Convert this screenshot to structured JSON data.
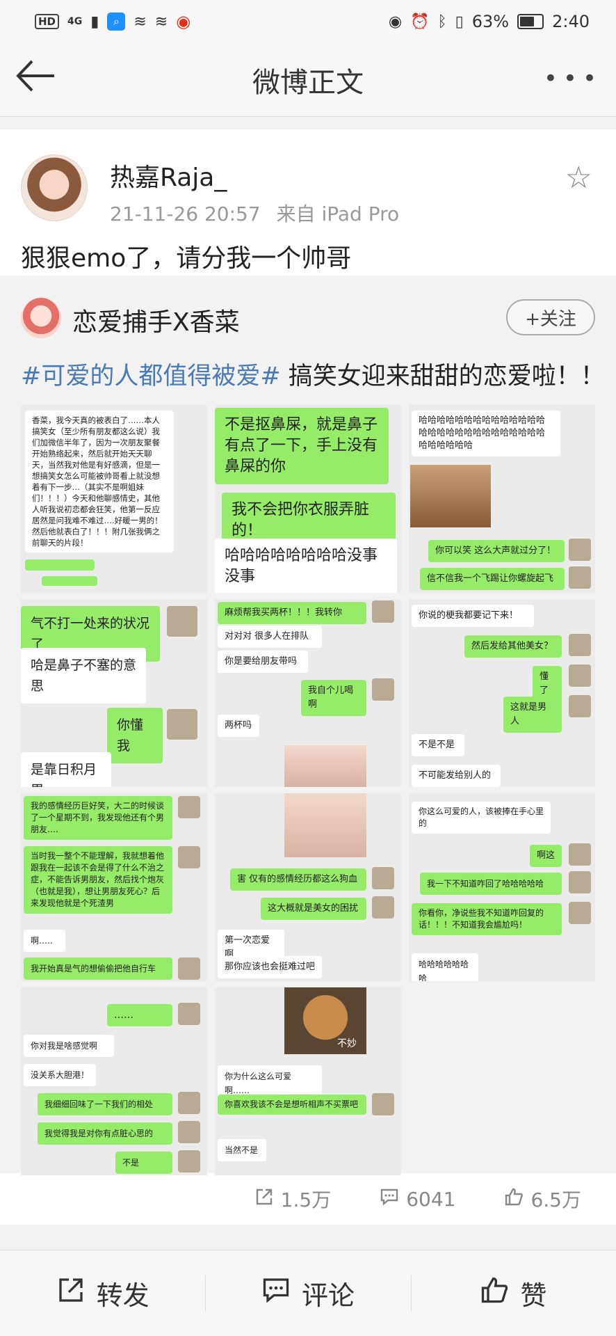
{
  "status_bar": {
    "left_badges": [
      "HD",
      "4G"
    ],
    "battery_percent": "63%",
    "time": "2:40"
  },
  "nav": {
    "title": "微博正文"
  },
  "post": {
    "author": "热嘉Raja_",
    "timestamp": "21-11-26 20:57",
    "source": "来自 iPad Pro",
    "text": "狠狠emo了，请分我一个帅哥"
  },
  "repost": {
    "author": "恋爱捕手X香菜",
    "follow_label": "+关注",
    "hashtag": "#可爱的人都值得被爱#",
    "text": " 搞笑女迎来甜甜的恋爱啦！！"
  },
  "grid": {
    "c1": {
      "story": "香菜，我今天真的被表白了……本人搞笑女（至少所有朋友都这么说）我们加微信半年了，因为一次朋友聚餐开始熟络起来，然后就开始天天聊天，当然我对他是有好感滴，但是一想搞笑女怎么可能被帅哥看上就没想着有下一步…（其实不是啊姐妹们！！！）今天和他聊感情史，其他人听我说初恋都会狂笑，他第一反应居然是问我难不难过….好暖一男的！然后他就表白了！！！附几张我俩之前聊天的片段！"
    },
    "c2": {
      "b1": "不是抠鼻屎，就是鼻子有点了一下，手上没有鼻屎的你",
      "b2": "我不会把你衣服弄脏的！",
      "b3": "哈哈哈哈哈哈哈哈没事没事"
    },
    "c3": {
      "b1": "哈哈哈哈哈哈哈哈哈哈哈哈哈哈哈哈哈哈哈哈哈哈哈哈哈哈哈哈哈哈哈哈哈哈",
      "b2": "你可以笑 这么大声就过分了！",
      "b3": "信不信我一个飞踢让你螺旋起飞"
    },
    "c4": {
      "b1": "气不打一处来的状况了",
      "b2": "哈是鼻子不塞的意思",
      "b3": "你懂我",
      "b4": "是靠日积月累"
    },
    "c5": {
      "b1": "麻烦帮我买两杯！！！我转你",
      "b2": "对对对 很多人在排队",
      "b3": "你是要给朋友带吗",
      "b4": "我自个儿喝啊",
      "b5": "两杯吗"
    },
    "c6": {
      "b1": "你说的梗我都要记下来！",
      "b2": "然后发给其他美女？",
      "b3": "懂了",
      "b4": "这就是男人",
      "b5": "不是不是",
      "b6": "不可能发给别人的"
    },
    "c7": {
      "b1": "我的感情经历巨好笑，大二的时候谈了一个星期不到，我发现他还有个男朋友….",
      "b2": "当时我一整个不能理解，我就想着他跟我在一起该不会是得了什么不治之症，不能告诉男朋友，然后找个炮灰（也就是我），想让男朋友死心？后来发现他就是个死渣男",
      "b3": "啊…..",
      "b4": "我开始真是气的想偷偷把他自行车"
    },
    "c8": {
      "b1": "害 仅有的感情经历都这么狗血",
      "b2": "这大概就是美女的困扰",
      "b3": "第一次恋爱啊",
      "b4": "那你应该也会挺难过吧"
    },
    "c9": {
      "b1": "你这么可爱的人，该被捧在手心里的",
      "b2": "啊这",
      "b3": "我一下不知道咋回了哈哈哈哈哈",
      "b4": "你看你，净说些我不知道咋回复的话！！！不知道我会尴尬吗！",
      "b5": "哈哈哈哈哈哈哈"
    },
    "c10": {
      "b1": "……",
      "b2": "你对我是啥感觉啊",
      "b3": "没关系大胆港！",
      "b4": "我细细回味了一下我们的相处",
      "b5": "我觉得我是对你有点脏心思的",
      "b6": "不是"
    },
    "c11": {
      "sticker": "不妙",
      "b1": "你为什么这么可爱啊……",
      "b2": "你喜欢我该不会是想听相声不买票吧",
      "b3": "当然不是"
    }
  },
  "stats": {
    "reposts": "1.5万",
    "comments": "6041",
    "likes": "6.5万"
  },
  "bottom_bar": {
    "repost": "转发",
    "comment": "评论",
    "like": "赞"
  }
}
